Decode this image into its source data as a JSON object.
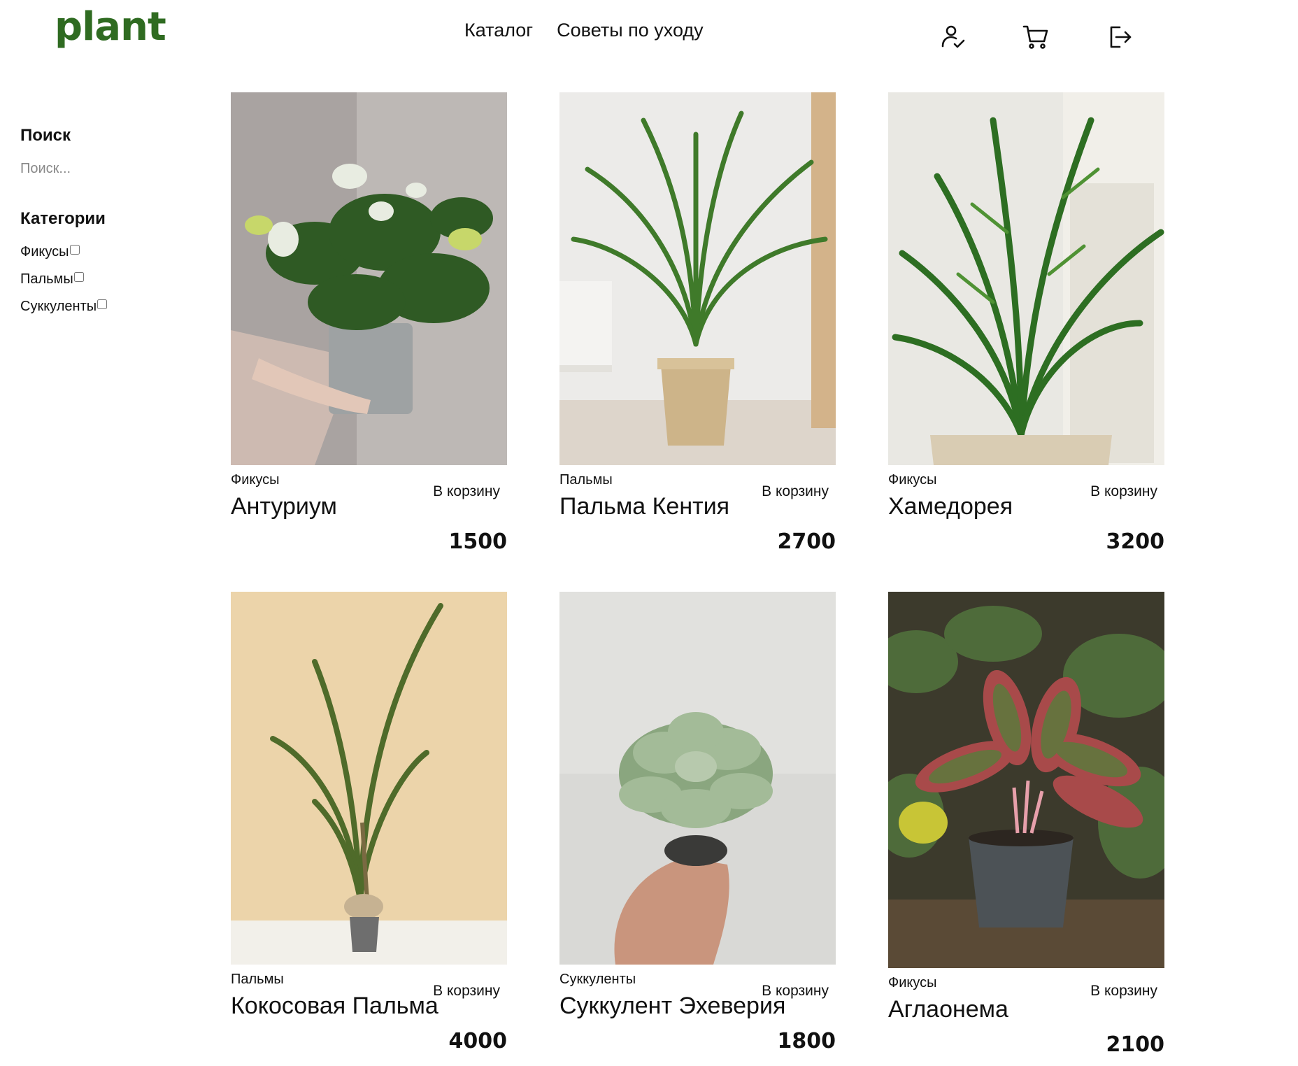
{
  "header": {
    "logo": "plant",
    "nav": [
      "Каталог",
      "Советы по уходу"
    ]
  },
  "icons": {
    "profile": "user-check-icon",
    "cart": "shopping-cart-icon",
    "logout": "logout-icon"
  },
  "sidebar": {
    "search_title": "Поиск",
    "search_placeholder": "Поиск...",
    "categories_title": "Категории",
    "categories": [
      "Фикусы",
      "Пальмы",
      "Суккуленты"
    ]
  },
  "products": [
    {
      "category": "Фикусы",
      "name": "Антуриум",
      "cart_label": "В корзину",
      "price": "1500"
    },
    {
      "category": "Пальмы",
      "name": "Пальма Кентия",
      "cart_label": "В корзину",
      "price": "2700"
    },
    {
      "category": "Фикусы",
      "name": "Хамедорея",
      "cart_label": "В корзину",
      "price": "3200"
    },
    {
      "category": "Пальмы",
      "name": "Кокосовая Пальма",
      "cart_label": "В корзину",
      "price": "4000"
    },
    {
      "category": "Суккуленты",
      "name": "Суккулент Эхеверия",
      "cart_label": "В корзину",
      "price": "1800"
    },
    {
      "category": "Фикусы",
      "name": "Аглаонема",
      "cart_label": "В корзину",
      "price": "2100"
    }
  ],
  "colors": {
    "brand": "#2f6b21",
    "text": "#111111"
  }
}
